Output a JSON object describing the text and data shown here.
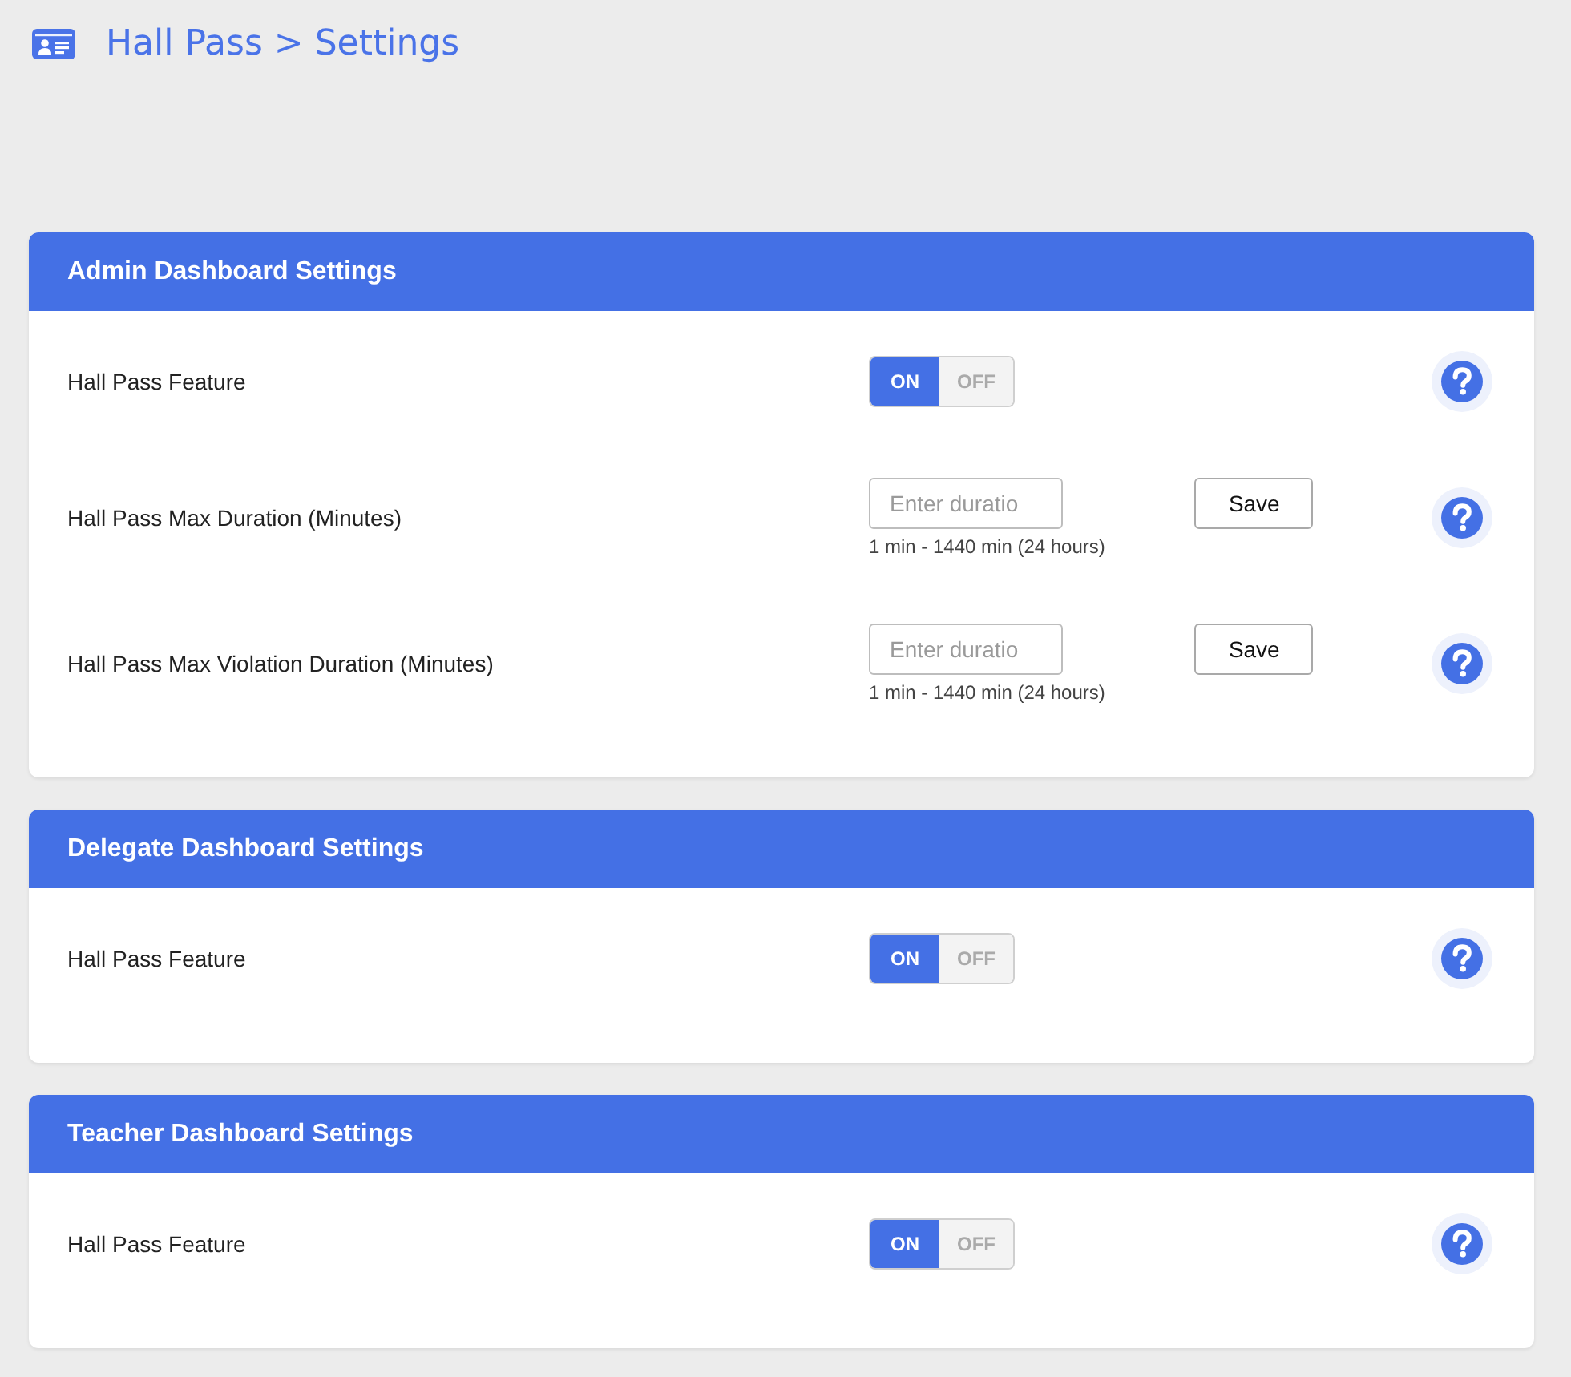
{
  "page_title": "Hall Pass > Settings",
  "sections": [
    {
      "title": "Admin Dashboard Settings",
      "rows": [
        {
          "kind": "toggle",
          "label": "Hall Pass Feature",
          "options": [
            {
              "label": "ON",
              "selected": true
            },
            {
              "label": "OFF",
              "selected": false
            }
          ]
        },
        {
          "kind": "duration",
          "label": "Hall Pass Max Duration (Minutes)",
          "placeholder": "Enter duratio",
          "button": "Save",
          "hint": "1 min - 1440 min (24 hours)"
        },
        {
          "kind": "duration",
          "label": "Hall Pass Max Violation Duration (Minutes)",
          "placeholder": "Enter duratio",
          "button": "Save",
          "hint": "1 min - 1440 min (24 hours)"
        }
      ]
    },
    {
      "title": "Delegate Dashboard Settings",
      "rows": [
        {
          "kind": "toggle",
          "label": "Hall Pass Feature",
          "options": [
            {
              "label": "ON",
              "selected": true
            },
            {
              "label": "OFF",
              "selected": false
            }
          ]
        }
      ]
    },
    {
      "title": "Teacher Dashboard Settings",
      "rows": [
        {
          "kind": "toggle",
          "label": "Hall Pass Feature",
          "options": [
            {
              "label": "ON",
              "selected": true
            },
            {
              "label": "OFF",
              "selected": false
            }
          ]
        }
      ]
    }
  ]
}
